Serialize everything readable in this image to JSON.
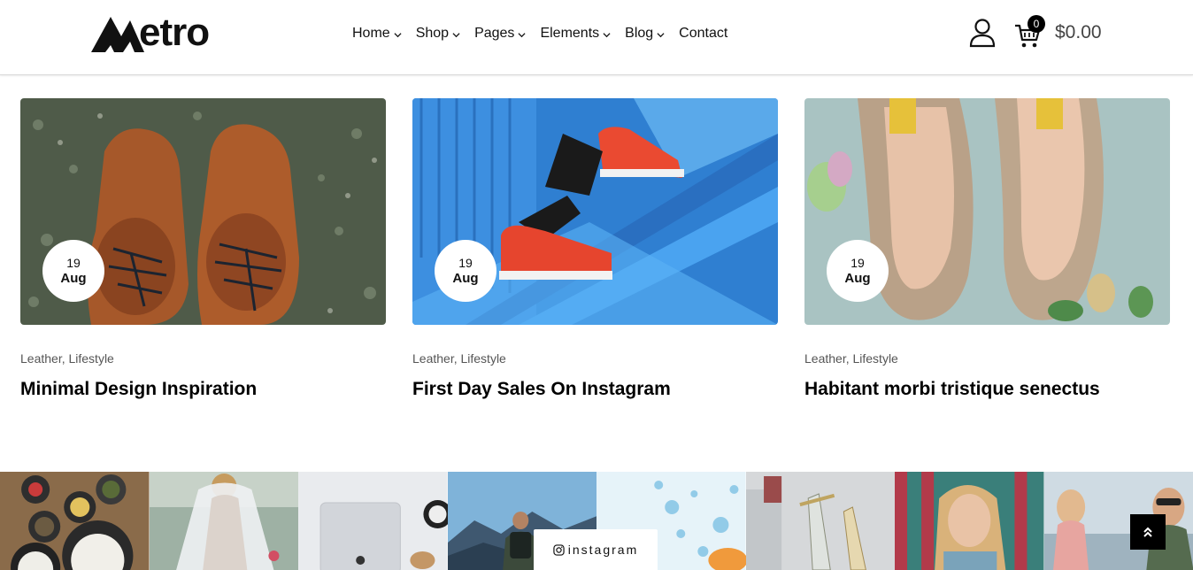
{
  "header": {
    "logo_text": "etro",
    "nav": [
      {
        "label": "Home",
        "has_dropdown": true
      },
      {
        "label": "Shop",
        "has_dropdown": true
      },
      {
        "label": "Pages",
        "has_dropdown": true
      },
      {
        "label": "Elements",
        "has_dropdown": true
      },
      {
        "label": "Blog",
        "has_dropdown": true
      },
      {
        "label": "Contact",
        "has_dropdown": false
      }
    ],
    "cart_count": "0",
    "cart_total": "$0.00",
    "icons": {
      "account": "user-icon",
      "cart": "cart-icon"
    }
  },
  "posts": [
    {
      "day": "19",
      "month": "Aug",
      "categories": "Leather, Lifestyle",
      "title": "Minimal Design Inspiration",
      "image": "brown-leather-shoes-on-grass"
    },
    {
      "day": "19",
      "month": "Aug",
      "categories": "Leather, Lifestyle",
      "title": "First Day Sales On Instagram",
      "image": "red-sneakers-on-blue-stairs"
    },
    {
      "day": "19",
      "month": "Aug",
      "categories": "Leather, Lifestyle",
      "title": "Habitant morbi tristique senectus",
      "image": "metallic-heels-with-flowers"
    }
  ],
  "instagram": {
    "label": "instagram",
    "tiles": [
      "food-bowls",
      "bride-veil",
      "laptop-desk",
      "hiker-mountains",
      "water-splash",
      "glass-vials",
      "woman-portrait",
      "women-beach"
    ]
  },
  "colors": {
    "accent": "#000000",
    "text": "#111111",
    "muted": "#555555"
  }
}
